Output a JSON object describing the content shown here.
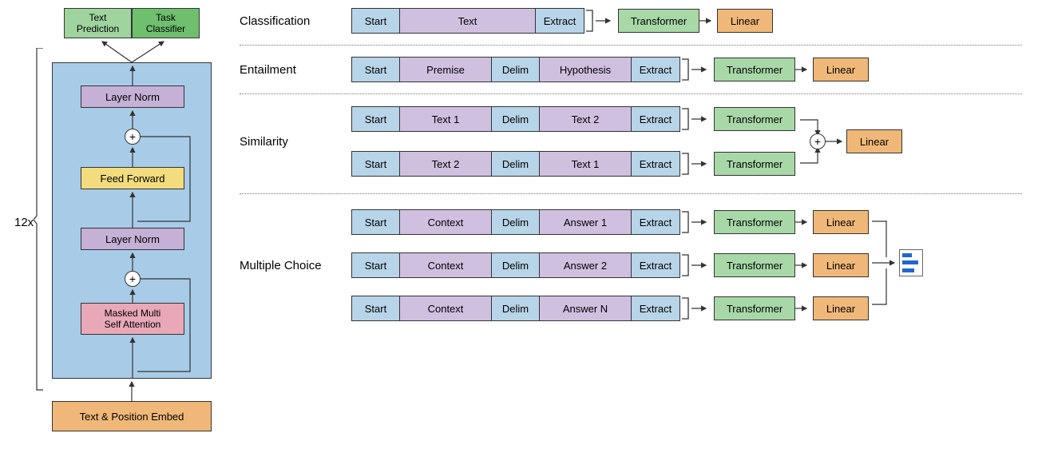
{
  "left": {
    "top_left": "Text\nPrediction",
    "top_right": "Task\nClassifier",
    "layer_norm": "Layer Norm",
    "feed_forward": "Feed Forward",
    "masked_attn": "Masked Multi\nSelf Attention",
    "embed": "Text & Position Embed",
    "repeat": "12x"
  },
  "tasks": {
    "classification": {
      "label": "Classification",
      "start": "Start",
      "text": "Text",
      "extract": "Extract",
      "transformer": "Transformer",
      "linear": "Linear"
    },
    "entailment": {
      "label": "Entailment",
      "start": "Start",
      "premise": "Premise",
      "delim": "Delim",
      "hypothesis": "Hypothesis",
      "extract": "Extract",
      "transformer": "Transformer",
      "linear": "Linear"
    },
    "similarity": {
      "label": "Similarity",
      "row1": {
        "start": "Start",
        "t1": "Text 1",
        "delim": "Delim",
        "t2": "Text 2",
        "extract": "Extract",
        "transformer": "Transformer"
      },
      "row2": {
        "start": "Start",
        "t1": "Text 2",
        "delim": "Delim",
        "t2": "Text 1",
        "extract": "Extract",
        "transformer": "Transformer"
      },
      "linear": "Linear"
    },
    "mc": {
      "label": "Multiple Choice",
      "rows": [
        {
          "start": "Start",
          "ctx": "Context",
          "delim": "Delim",
          "ans": "Answer 1",
          "extract": "Extract",
          "transformer": "Transformer",
          "linear": "Linear"
        },
        {
          "start": "Start",
          "ctx": "Context",
          "delim": "Delim",
          "ans": "Answer 2",
          "extract": "Extract",
          "transformer": "Transformer",
          "linear": "Linear"
        },
        {
          "start": "Start",
          "ctx": "Context",
          "delim": "Delim",
          "ans": "Answer N",
          "extract": "Extract",
          "transformer": "Transformer",
          "linear": "Linear"
        }
      ]
    }
  }
}
